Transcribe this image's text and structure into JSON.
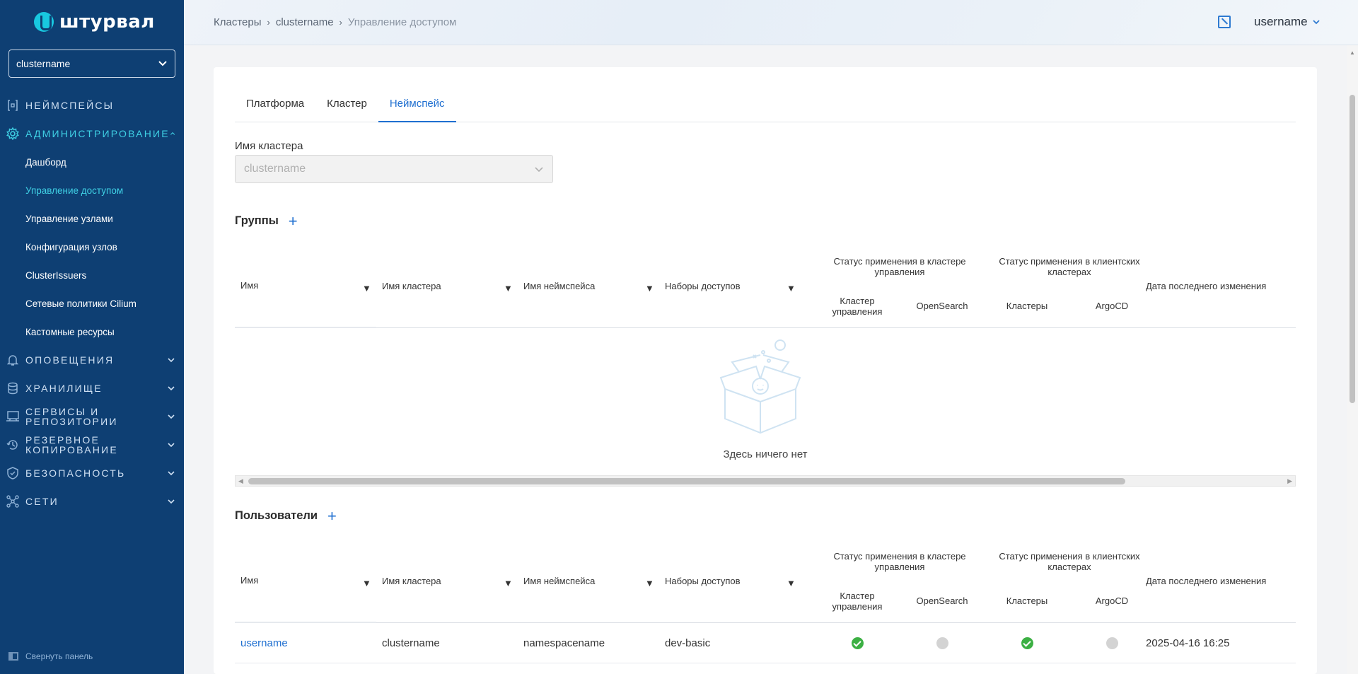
{
  "app": {
    "logo_text": "штурвал"
  },
  "sidebar": {
    "cluster_select": "clustername",
    "nav": [
      {
        "label": "Неймспейсы",
        "icon": "braces-icon"
      },
      {
        "label": "Администрирование",
        "icon": "gear-icon",
        "expanded": true,
        "items": [
          "Дашборд",
          "Управление доступом",
          "Управление узлами",
          "Конфигурация узлов",
          "ClusterIssuers",
          "Сетевые политики Cilium",
          "Кастомные ресурсы"
        ],
        "active_item": "Управление доступом"
      },
      {
        "label": "Оповещения",
        "icon": "bell-icon"
      },
      {
        "label": "Хранилище",
        "icon": "database-icon"
      },
      {
        "label": "Сервисы и репозитории",
        "icon": "monitor-icon"
      },
      {
        "label": "Резервное копирование",
        "icon": "history-icon"
      },
      {
        "label": "Безопасность",
        "icon": "shield-icon"
      },
      {
        "label": "Сети",
        "icon": "network-icon"
      }
    ],
    "collapse_label": "Свернуть панель"
  },
  "header": {
    "breadcrumb": [
      "Кластеры",
      "clustername",
      "Управление доступом"
    ],
    "username": "username"
  },
  "tabs": [
    "Платформа",
    "Кластер",
    "Неймспейс"
  ],
  "active_tab": "Неймспейс",
  "cluster_field": {
    "label": "Имя кластера",
    "value": "clustername"
  },
  "columns": {
    "name": "Имя",
    "cluster": "Имя кластера",
    "namespace": "Имя неймспейса",
    "access_sets": "Наборы доступов",
    "mgmt_status": "Статус применения в кластере управления",
    "client_status": "Статус применения в клиентских кластерах",
    "mgmt_cluster": "Кластер управления",
    "opensearch": "OpenSearch",
    "clusters": "Кластеры",
    "argocd": "ArgoCD",
    "last_modified": "Дата последнего изменения"
  },
  "groups": {
    "title": "Группы",
    "empty_text": "Здесь ничего нет",
    "rows": []
  },
  "users": {
    "title": "Пользователи",
    "rows": [
      {
        "name": "username",
        "cluster": "clustername",
        "namespace": "namespacename",
        "access_set": "dev-basic",
        "mgmt_cluster": "ok",
        "opensearch": "off",
        "clusters": "ok",
        "argocd": "off",
        "last_modified": "2025-04-16 16:25"
      }
    ]
  },
  "colors": {
    "sidebar": "#0e3f73",
    "accent": "#1f6fd0",
    "active_nav": "#3fd0e4",
    "success": "#3cb043"
  }
}
